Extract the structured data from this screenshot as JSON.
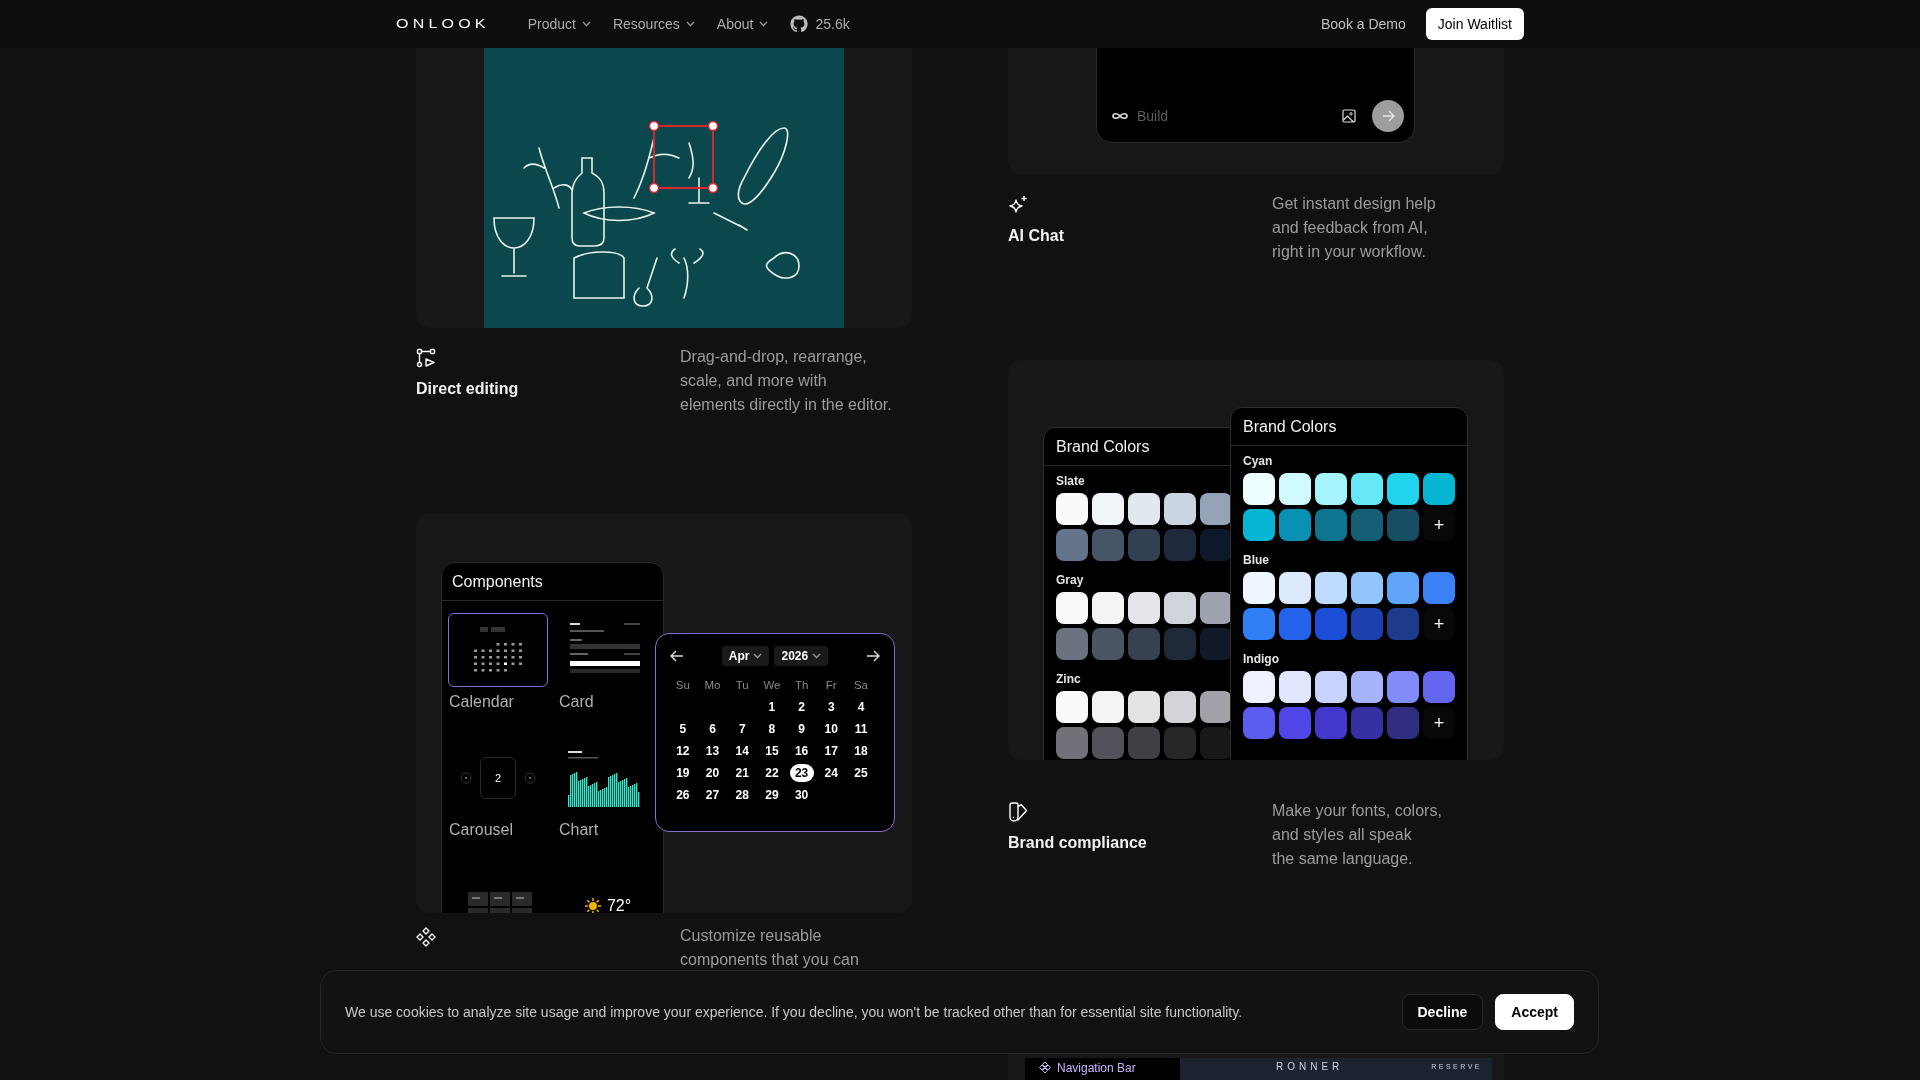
{
  "nav": {
    "logo": "ONLOOK",
    "menus": [
      {
        "label": "Product"
      },
      {
        "label": "Resources"
      },
      {
        "label": "About"
      }
    ],
    "github_stars": "25.6k",
    "demo_link": "Book a Demo",
    "cta": "Join Waitlist"
  },
  "left_column": {
    "editing_feature": {
      "title": "Direct editing",
      "description": "Drag-and-drop, rearrange,\nscale, and more with\nelements directly in the editor."
    },
    "components_card": {
      "panel_title": "Components",
      "items": [
        {
          "label": "Calendar",
          "kind": "calendar",
          "selected": true
        },
        {
          "label": "Card",
          "kind": "card",
          "selected": false
        },
        {
          "label": "Carousel",
          "kind": "carousel",
          "value": "2",
          "selected": false
        },
        {
          "label": "Chart",
          "kind": "chart",
          "selected": false
        },
        {
          "kind": "table",
          "selected": false
        },
        {
          "kind": "weather",
          "value": "72°",
          "selected": false
        }
      ],
      "calendar": {
        "month": "Apr",
        "year": "2026",
        "weekdays": [
          "Su",
          "Mo",
          "Tu",
          "We",
          "Th",
          "Fr",
          "Sa"
        ],
        "weeks": [
          [
            {
              "day": "1",
              "selected": false
            },
            {
              "day": "2",
              "selected": false
            },
            {
              "day": "3",
              "selected": false
            },
            {
              "day": "4",
              "selected": false
            }
          ],
          [
            {
              "day": "5",
              "selected": false
            },
            {
              "day": "6",
              "selected": false
            },
            {
              "day": "7",
              "selected": false
            },
            {
              "day": "8",
              "selected": false
            },
            {
              "day": "9",
              "selected": false
            },
            {
              "day": "10",
              "selected": false
            },
            {
              "day": "11",
              "selected": false
            }
          ],
          [
            {
              "day": "12",
              "selected": false
            },
            {
              "day": "13",
              "selected": false
            },
            {
              "day": "14",
              "selected": false
            },
            {
              "day": "15",
              "selected": false
            },
            {
              "day": "16",
              "selected": false
            },
            {
              "day": "17",
              "selected": false
            },
            {
              "day": "18",
              "selected": false
            }
          ],
          [
            {
              "day": "19",
              "selected": false
            },
            {
              "day": "20",
              "selected": false
            },
            {
              "day": "21",
              "selected": false
            },
            {
              "day": "22",
              "selected": false
            },
            {
              "day": "23",
              "selected": true
            },
            {
              "day": "24",
              "selected": false
            },
            {
              "day": "25",
              "selected": false
            }
          ],
          [
            {
              "day": "26",
              "selected": false
            },
            {
              "day": "27",
              "selected": false
            },
            {
              "day": "28",
              "selected": false
            },
            {
              "day": "29",
              "selected": false
            },
            {
              "day": "30",
              "selected": false
            }
          ]
        ]
      }
    },
    "components_feature": {
      "description": "Customize reusable\ncomponents that you can"
    }
  },
  "right_column": {
    "chat_card": {
      "placeholder": "Build"
    },
    "chat_feature": {
      "title": "AI Chat",
      "description": "Get instant design help\nand feedback from AI,\nright in your workflow."
    },
    "brand_card": {
      "panels": [
        {
          "title": "Brand Colors",
          "palettes": [
            {
              "name": "Slate",
              "swatches": [
                {
                  "color": "#f8fafc"
                },
                {
                  "color": "#f1f5f9"
                },
                {
                  "color": "#e2e8f0"
                },
                {
                  "color": "#cbd5e1"
                },
                {
                  "color": "#94a3b8"
                },
                {
                  "color": "#64748b"
                },
                {
                  "color": "#475569"
                },
                {
                  "color": "#334155"
                },
                {
                  "color": "#1e293b"
                },
                {
                  "color": "#0f172a"
                }
              ]
            },
            {
              "name": "Gray",
              "swatches": [
                {
                  "color": "#f9fafb"
                },
                {
                  "color": "#f3f4f6"
                },
                {
                  "color": "#e5e7eb"
                },
                {
                  "color": "#d1d5db"
                },
                {
                  "color": "#9ca3af"
                },
                {
                  "color": "#6b7280"
                },
                {
                  "color": "#4b5563"
                },
                {
                  "color": "#374151"
                },
                {
                  "color": "#1f2937"
                },
                {
                  "color": "#111827"
                }
              ]
            },
            {
              "name": "Zinc",
              "swatches": [
                {
                  "color": "#fafafa"
                },
                {
                  "color": "#f4f4f5"
                },
                {
                  "color": "#e4e4e7"
                },
                {
                  "color": "#d4d4d8"
                },
                {
                  "color": "#a1a1aa"
                },
                {
                  "color": "#71717a"
                },
                {
                  "color": "#52525b"
                },
                {
                  "color": "#3f3f46"
                },
                {
                  "color": "#27272a"
                },
                {
                  "color": "#18181b"
                }
              ]
            }
          ]
        },
        {
          "title": "Brand Colors",
          "palettes": [
            {
              "name": "Cyan",
              "add_label": "+",
              "swatches": [
                {
                  "color": "#ecfeff"
                },
                {
                  "color": "#cffafe"
                },
                {
                  "color": "#a5f3fc"
                },
                {
                  "color": "#67e8f9"
                },
                {
                  "color": "#22d3ee"
                },
                {
                  "color": "#06b6d4"
                },
                {
                  "color": "#06b6d4"
                },
                {
                  "color": "#0891b2"
                },
                {
                  "color": "#0e7490"
                },
                {
                  "color": "#155e75"
                },
                {
                  "color": "#164e63"
                }
              ]
            },
            {
              "name": "Blue",
              "add_label": "+",
              "swatches": [
                {
                  "color": "#eff6ff"
                },
                {
                  "color": "#dbeafe"
                },
                {
                  "color": "#bfdbfe"
                },
                {
                  "color": "#93c5fd"
                },
                {
                  "color": "#60a5fa"
                },
                {
                  "color": "#3b82f6"
                },
                {
                  "color": "#2f7ff5"
                },
                {
                  "color": "#2563eb"
                },
                {
                  "color": "#1d4ed8"
                },
                {
                  "color": "#1e40af"
                },
                {
                  "color": "#1e3a8a"
                }
              ]
            },
            {
              "name": "Indigo",
              "add_label": "+",
              "swatches": [
                {
                  "color": "#eef2ff"
                },
                {
                  "color": "#e0e7ff"
                },
                {
                  "color": "#c7d2fe"
                },
                {
                  "color": "#a5b4fc"
                },
                {
                  "color": "#818cf8"
                },
                {
                  "color": "#6366f1"
                },
                {
                  "color": "#5b5cf0"
                },
                {
                  "color": "#4f46e5"
                },
                {
                  "color": "#4338ca"
                },
                {
                  "color": "#3730a3"
                },
                {
                  "color": "#312e81"
                }
              ]
            }
          ]
        }
      ]
    },
    "brand_feature": {
      "title": "Brand compliance",
      "description": "Make your fonts, colors,\nand styles all speak\nthe same language."
    },
    "navbar_card": {
      "label": "Navigation Bar",
      "brand": "RONNER",
      "link": "RESERVE"
    }
  },
  "cookie_banner": {
    "message": "We use cookies to analyze site usage and improve your experience. If you decline, you won't be tracked other than for essential site functionality.",
    "buttons": [
      {
        "label": "Decline",
        "kind": "secondary"
      },
      {
        "label": "Accept",
        "kind": "primary"
      }
    ]
  }
}
